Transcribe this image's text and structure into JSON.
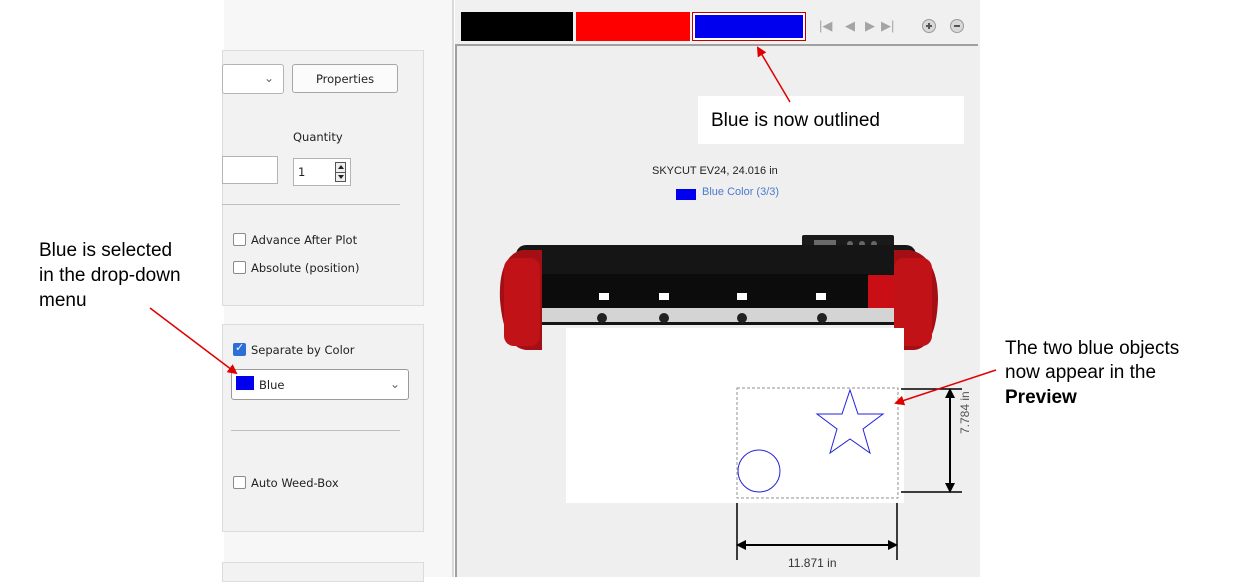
{
  "annotations": {
    "outlined": "Blue is now outlined",
    "selected_line1": "Blue is selected",
    "selected_line2": "in the drop-down",
    "selected_line3": "menu",
    "objects_line1": "The two blue objects",
    "objects_line2": "now appear in the",
    "objects_line3": "Preview"
  },
  "settings": {
    "properties_button": "Properties",
    "quantity_label": "Quantity",
    "quantity_value": "1",
    "advance_after_plot": "Advance After Plot",
    "absolute_position": "Absolute (position)",
    "separate_by_color": "Separate by Color",
    "selected_color": "Blue",
    "auto_weed_box": "Auto Weed-Box"
  },
  "preview": {
    "color_tabs": [
      "Black",
      "Red",
      "Blue"
    ],
    "tab_colors": [
      "#000000",
      "#ff0000",
      "#0000ee"
    ],
    "active_tab": "Blue",
    "cutter_info": "SKYCUT EV24,  24.016 in",
    "color_info": "Blue Color (3/3)",
    "height_dim": "7.784 in",
    "width_dim": "11.871 in"
  },
  "colors": {
    "arrow": "#e00000",
    "accent_blue": "#0000ee",
    "checkbox_blue": "#2d6fd6"
  }
}
